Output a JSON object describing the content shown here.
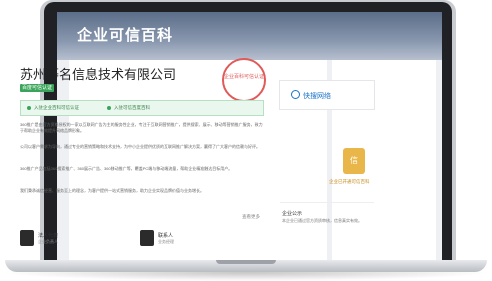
{
  "banner": {
    "title": "企业可信百科"
  },
  "company": {
    "name": "苏州蓦名信息技术有限公司",
    "badge": "百度可信认证",
    "stamp": "企业百科可信认证"
  },
  "highlights": [
    {
      "label": "入驻企业百科可信认证"
    },
    {
      "label": "入驻可信百度百科"
    }
  ],
  "paragraphs": [
    "360推广是由官方资格授权的一家以互联网广告为主的服务性企业，专注于互联网营销推广，提供搜索、展示、移动等营销推广服务，致力于帮助企业有效提升网络品牌形象。",
    "公司以客户需求为导向，通过专业的营销策略和技术支持，为中小企业提供优质的互联网推广解决方案，赢得了广大客户的信赖与好评。",
    "360推广产品包括360搜索推广、360展示广告、360移动推广等，覆盖PC端与移动端流量，帮助企业精准触达目标用户。",
    "我们秉承诚信经营、服务至上的理念，为客户提供一站式营销服务，助力企业实现品牌价值与业务增长。"
  ],
  "more_label": "查看更多",
  "people": [
    {
      "name": "法人代表",
      "role": "企业负责人"
    },
    {
      "name": "联系人",
      "role": "业务经理"
    }
  ],
  "side": {
    "logo_text": "快搜网络",
    "medal_char": "信",
    "medal_label": "企业已开通可信百科",
    "heading": "企业公示",
    "text": "本企业已通过官方资质审核，信息真实有效。"
  }
}
